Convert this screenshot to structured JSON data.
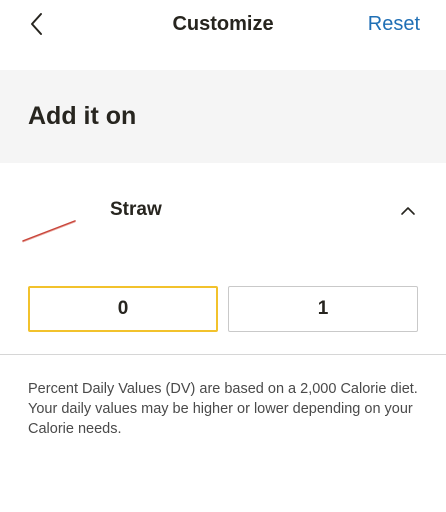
{
  "header": {
    "title": "Customize",
    "reset_label": "Reset",
    "back_icon": "chevron-left-icon"
  },
  "section": {
    "title": "Add it on"
  },
  "item": {
    "name": "Straw",
    "image_icon": "straw-icon",
    "toggle_icon": "chevron-up-icon",
    "expanded": true
  },
  "quantity": {
    "options": [
      "0",
      "1"
    ],
    "selected": "0",
    "selected_color": "#f2c22c"
  },
  "disclaimer": "Percent Daily Values (DV) are based on a 2,000 Calorie diet. Your daily values may be higher or lower depending on your Calorie needs.",
  "colors": {
    "accent": "#1f6fb5",
    "text": "#27251f",
    "band": "#f5f5f5"
  }
}
